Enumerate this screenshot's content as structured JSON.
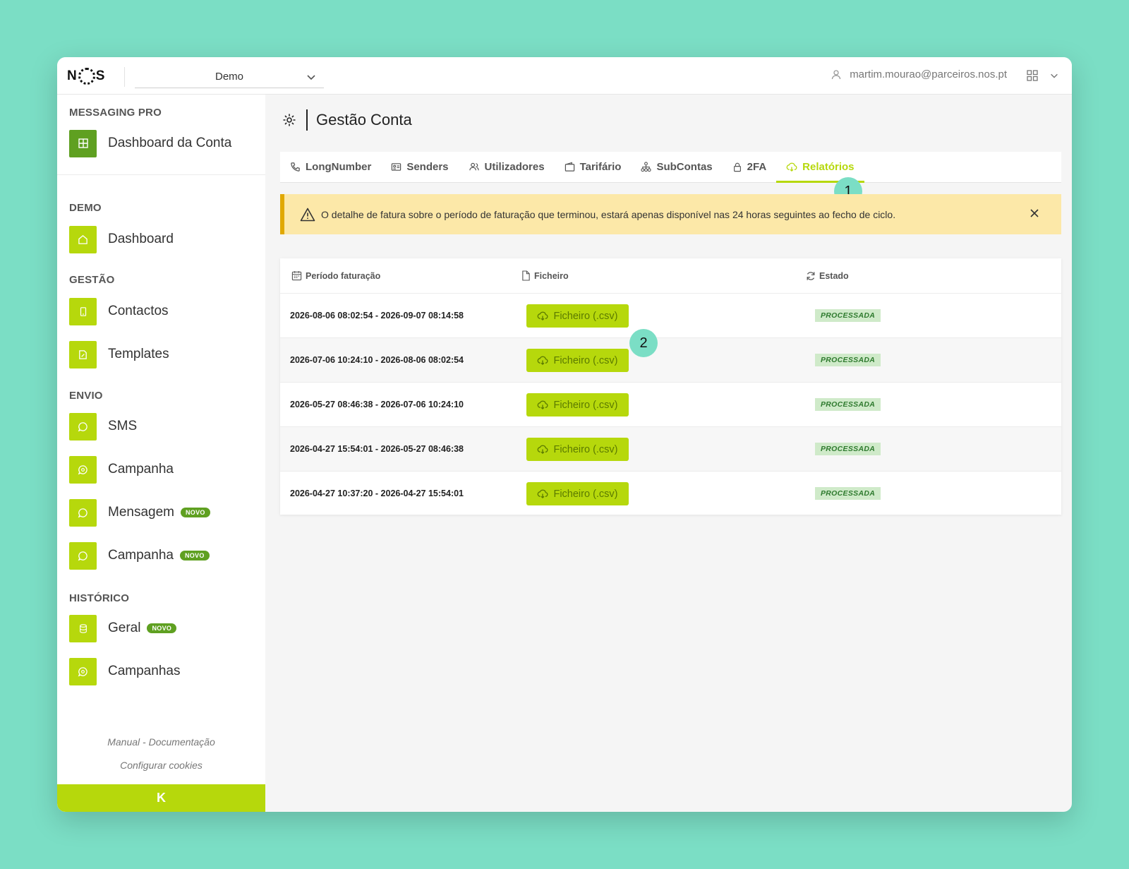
{
  "topbar": {
    "logo": "NOS",
    "account_selected": "Demo",
    "user_email": "martim.mourao@parceiros.nos.pt"
  },
  "sidebar": {
    "sections": {
      "messaging_pro": "MESSAGING PRO",
      "demo": "DEMO",
      "gestao": "GESTÃO",
      "envio": "ENVIO",
      "historico": "HISTÓRICO"
    },
    "items": {
      "dashboard_conta": "Dashboard da Conta",
      "dashboard": "Dashboard",
      "contactos": "Contactos",
      "templates": "Templates",
      "sms": "SMS",
      "campanha": "Campanha",
      "mensagem": "Mensagem",
      "campanha_novo": "Campanha",
      "geral": "Geral",
      "campanhas": "Campanhas"
    },
    "badge_novo": "NOVO",
    "footer": {
      "manual": "Manual - Documentação",
      "cookies": "Configurar cookies"
    },
    "collapse_label": "K"
  },
  "main": {
    "page_title": "Gestão Conta",
    "tabs": [
      {
        "label": "LongNumber",
        "icon": "phone-icon"
      },
      {
        "label": "Senders",
        "icon": "id-card-icon"
      },
      {
        "label": "Utilizadores",
        "icon": "users-icon"
      },
      {
        "label": "Tarifário",
        "icon": "wallet-icon"
      },
      {
        "label": "SubContas",
        "icon": "hierarchy-icon"
      },
      {
        "label": "2FA",
        "icon": "lock-icon"
      },
      {
        "label": "Relatórios",
        "icon": "cloud-download-icon",
        "active": true
      }
    ],
    "callouts": [
      "1",
      "2"
    ],
    "alert_text": "O detalhe de fatura sobre o período de faturação que terminou, estará apenas disponível nas 24 horas seguintes ao fecho de ciclo.",
    "table": {
      "headers": {
        "period": "Período faturação",
        "file": "Ficheiro",
        "status": "Estado"
      },
      "rows": [
        {
          "period": "2026-08-06 08:02:54 - 2026-09-07 08:14:58",
          "file": "Ficheiro (.csv)",
          "status": "PROCESSADA"
        },
        {
          "period": "2026-07-06 10:24:10 - 2026-08-06 08:02:54",
          "file": "Ficheiro (.csv)",
          "status": "PROCESSADA"
        },
        {
          "period": "2026-05-27 08:46:38 - 2026-07-06 10:24:10",
          "file": "Ficheiro (.csv)",
          "status": "PROCESSADA"
        },
        {
          "period": "2026-04-27 15:54:01 - 2026-05-27 08:46:38",
          "file": "Ficheiro (.csv)",
          "status": "PROCESSADA"
        },
        {
          "period": "2026-04-27 10:37:20 - 2026-04-27 15:54:01",
          "file": "Ficheiro (.csv)",
          "status": "PROCESSADA"
        }
      ]
    }
  },
  "colors": {
    "accent": "#b6d80c",
    "accent_dark": "#5fa021",
    "background": "#7bdec5",
    "alert_bg": "#fce8a8",
    "status_bg": "#cfeac9"
  }
}
